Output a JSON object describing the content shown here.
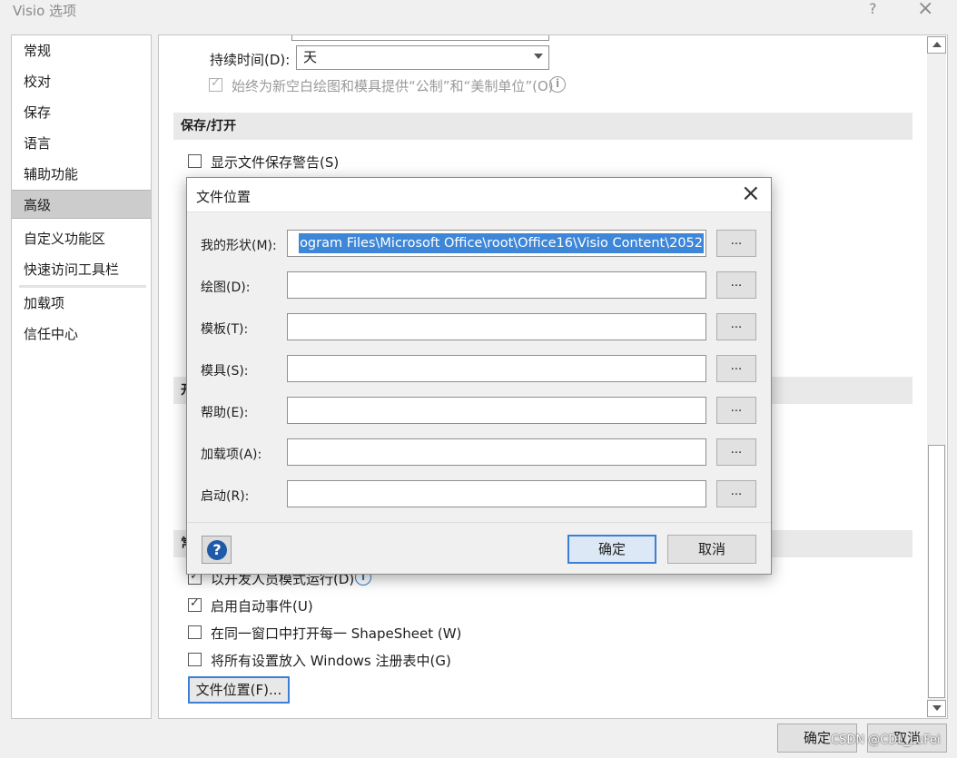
{
  "window": {
    "title": "Visio 选项",
    "help": "?",
    "close": "×"
  },
  "nav": {
    "items": [
      "常规",
      "校对",
      "保存",
      "语言",
      "辅助功能",
      "高级",
      "自定义功能区",
      "快速访问工具栏",
      "加载项",
      "信任中心"
    ],
    "selected": "高级"
  },
  "content": {
    "top_field_label": "持续时间(D):",
    "top_field_value": "天",
    "metric_option": "始终为新空白绘图和模具提供“公制”和“美制单位”(O)",
    "section_save": "保存/打开",
    "show_save_warning": "显示文件保存警告(S)",
    "hidden_section_char": "开",
    "hidden_section2_char": "常",
    "dev_mode": "以开发人员模式运行(D)",
    "auto_events": "启用自动事件(U)",
    "shapesheet": "在同一窗口中打开每一 ShapeSheet (W)",
    "registry": "将所有设置放入 Windows 注册表中(G)",
    "file_locations_button": "文件位置(F)...",
    "ok": "确定",
    "cancel": "取消"
  },
  "dialog": {
    "title": "文件位置",
    "close": "×",
    "rows": [
      {
        "label": "我的形状(M):",
        "value": "ogram Files\\Microsoft Office\\root\\Office16\\Visio Content\\2052"
      },
      {
        "label": "绘图(D):",
        "value": ""
      },
      {
        "label": "模板(T):",
        "value": ""
      },
      {
        "label": "模具(S):",
        "value": ""
      },
      {
        "label": "帮助(E):",
        "value": ""
      },
      {
        "label": "加载项(A):",
        "value": ""
      },
      {
        "label": "启动(R):",
        "value": ""
      }
    ],
    "browse": "...",
    "ok": "确定",
    "cancel": "取消",
    "help_icon": "?"
  },
  "watermark": "CSDN @CDL_LuFei",
  "colors": {
    "accent": "#3c7fd6",
    "selection": "#3e87d8",
    "nav_selected": "#cccccc"
  }
}
